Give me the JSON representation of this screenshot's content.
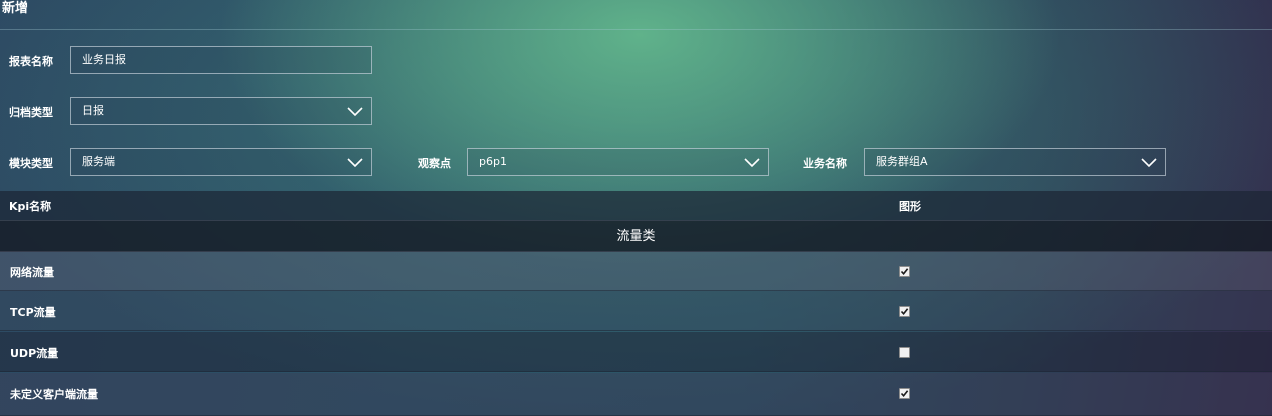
{
  "header": {
    "title": "新增"
  },
  "form": {
    "report_name": {
      "label": "报表名称",
      "value": "业务日报"
    },
    "archive_type": {
      "label": "归档类型",
      "value": "日报"
    },
    "module_type": {
      "label": "模块类型",
      "value": "服务端"
    },
    "observation_point": {
      "label": "观察点",
      "value": "p6p1"
    },
    "business_name": {
      "label": "业务名称",
      "value": "服务群组A"
    }
  },
  "table": {
    "columns": [
      "Kpi名称",
      "图形"
    ],
    "group": "流量类",
    "rows": [
      {
        "name": "网络流量",
        "checked": true
      },
      {
        "name": "TCP流量",
        "checked": true
      },
      {
        "name": "UDP流量",
        "checked": false
      },
      {
        "name": "未定义客户端流量",
        "checked": true
      }
    ]
  },
  "icons": {
    "dropdown": "chevron-down-icon",
    "checkmark": "checkmark-icon"
  }
}
